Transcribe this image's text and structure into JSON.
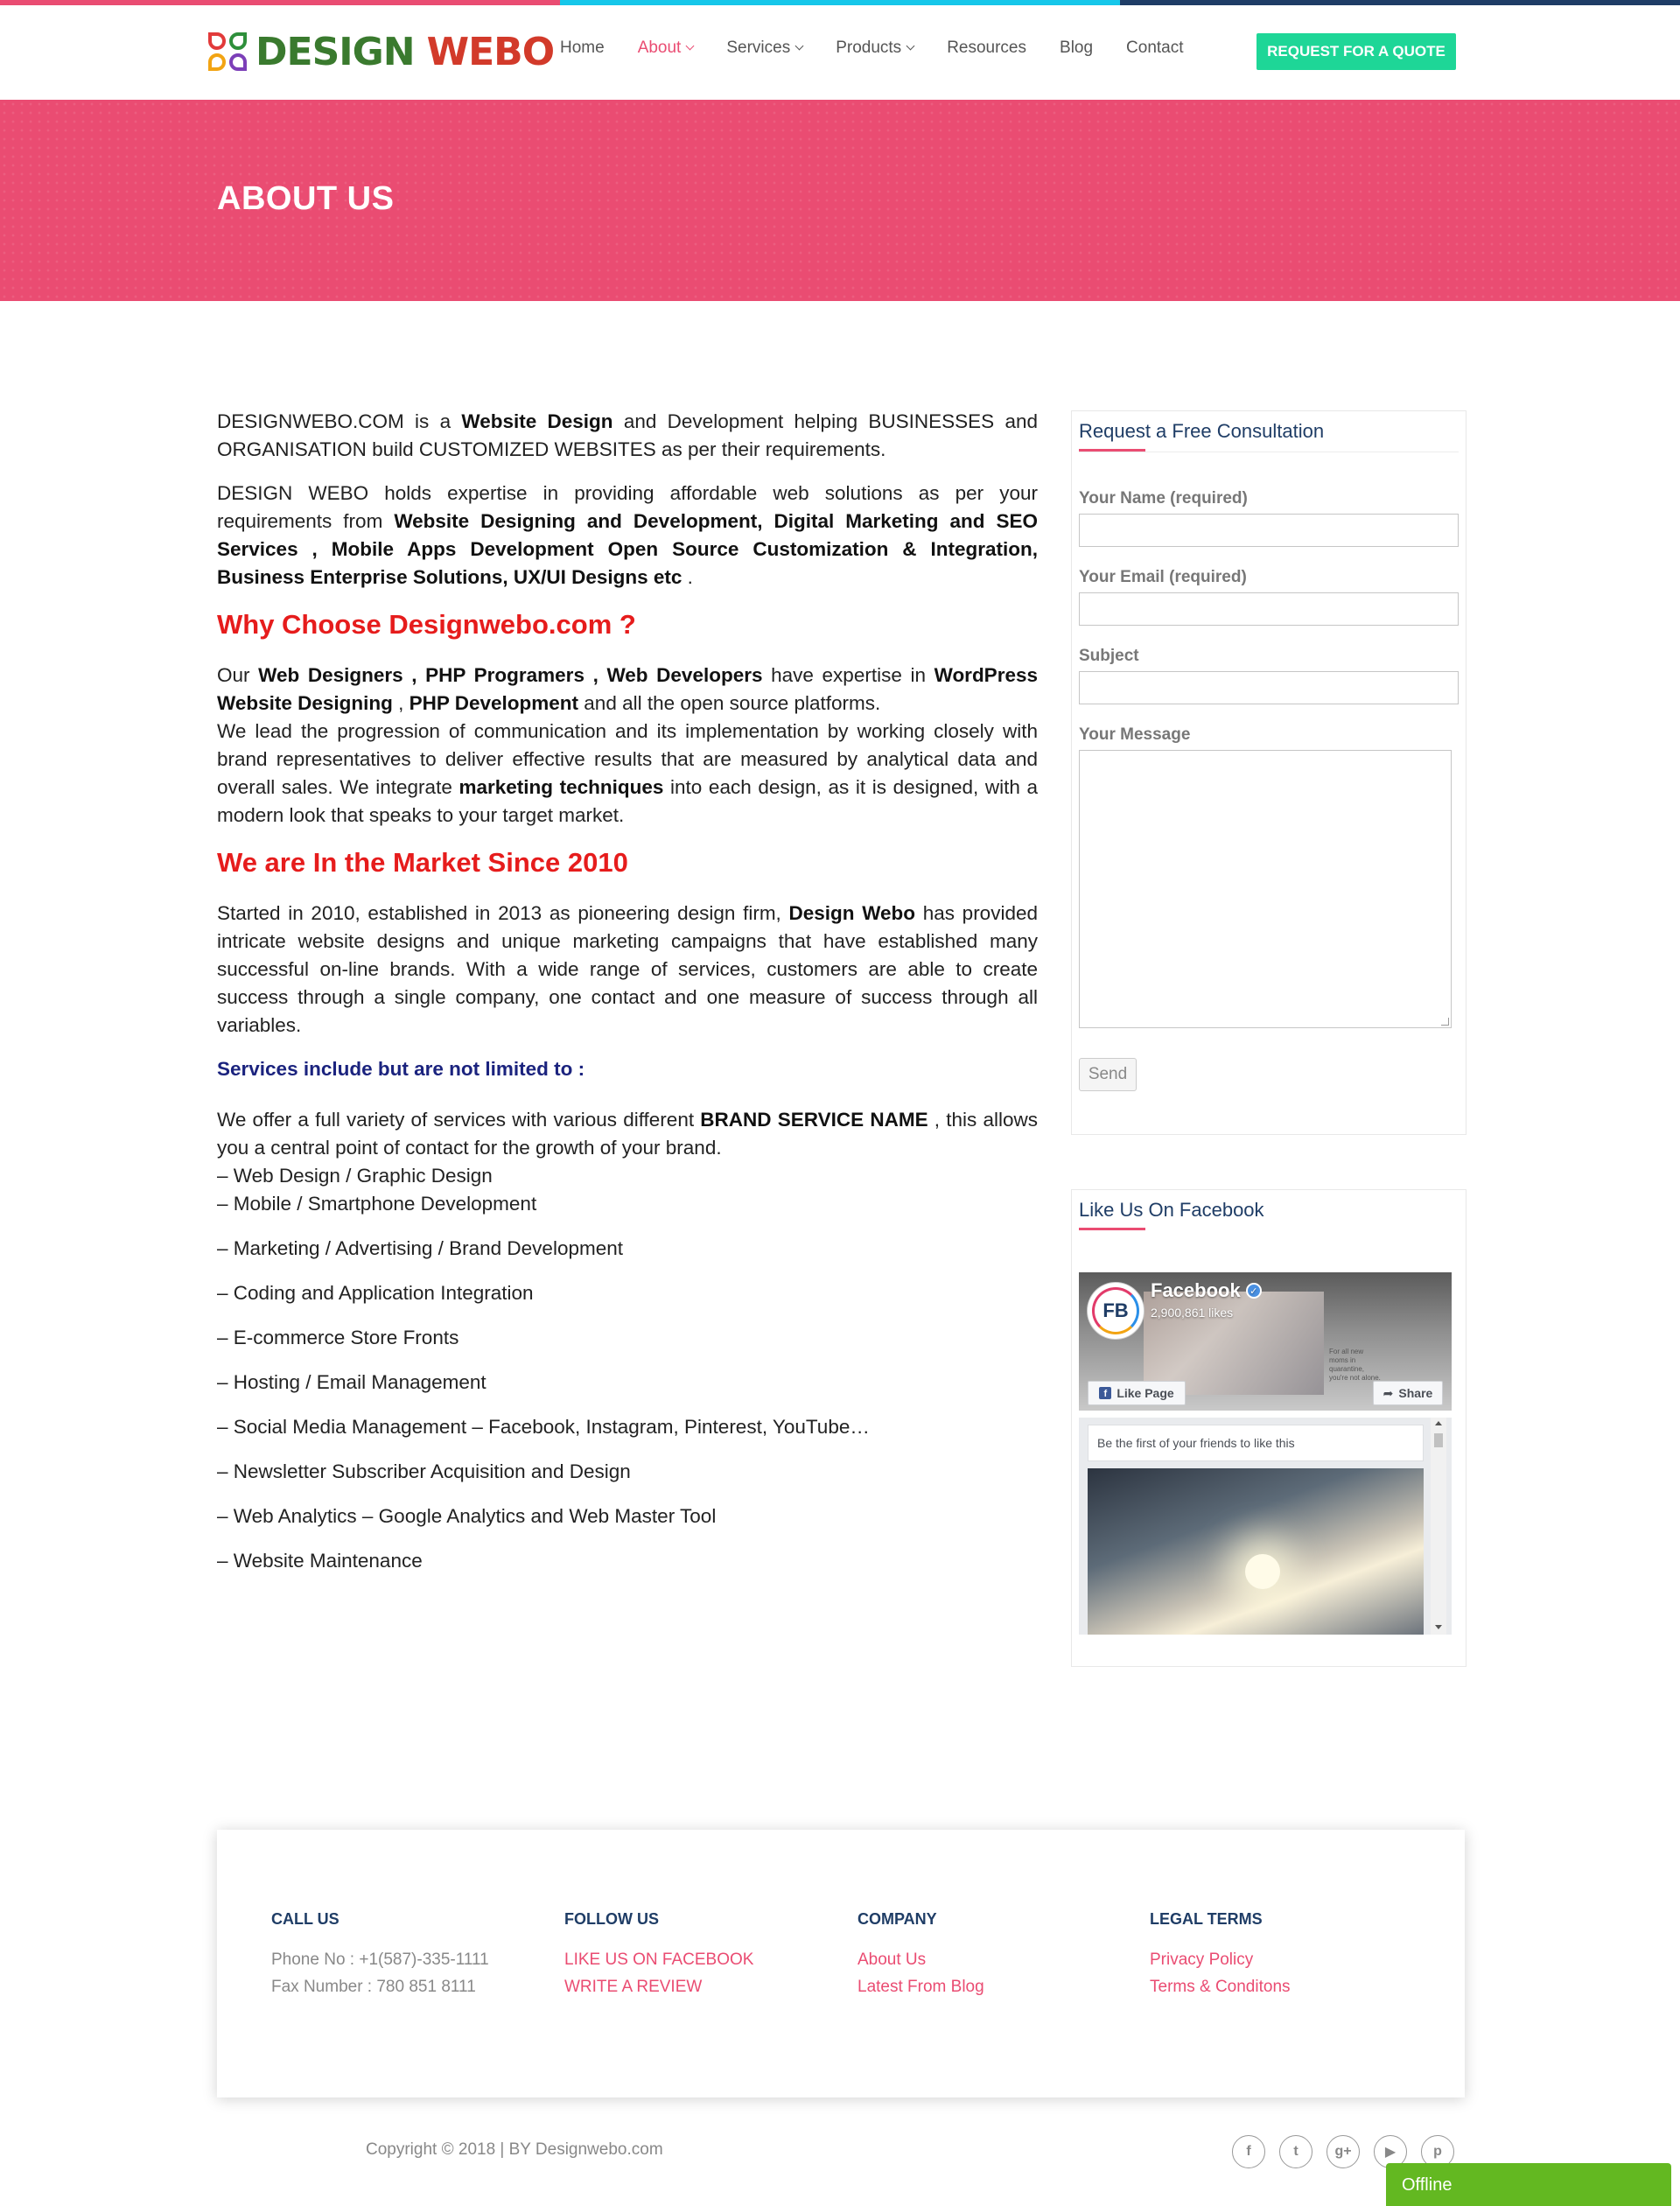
{
  "colors": {
    "accent": "#ea4c72",
    "cyan": "#16c7ea",
    "navy": "#1f3d66",
    "quote_button": "#1ed697",
    "heading_red": "#e61c1c",
    "offline_green": "#63b821"
  },
  "header": {
    "logo": {
      "word1": "DESIGN",
      "word2": "WEBO"
    },
    "nav": [
      {
        "label": "Home",
        "dropdown": false,
        "active": false
      },
      {
        "label": "About",
        "dropdown": true,
        "active": true
      },
      {
        "label": "Services",
        "dropdown": true,
        "active": false
      },
      {
        "label": "Products",
        "dropdown": true,
        "active": false
      },
      {
        "label": "Resources",
        "dropdown": false,
        "active": false
      },
      {
        "label": "Blog",
        "dropdown": false,
        "active": false
      },
      {
        "label": "Contact",
        "dropdown": false,
        "active": false
      }
    ],
    "quote_button": "REQUEST FOR A QUOTE"
  },
  "hero": {
    "title": "ABOUT US"
  },
  "content": {
    "p1_a": "DESIGNWEBO.COM is a ",
    "p1_b": "Website Design",
    "p1_c": " and Development helping BUSINESSES and ORGANISATION build CUSTOMIZED WEBSITES as per their requirements.",
    "p2_a": "DESIGN WEBO holds expertise in providing affordable web solutions as per your requirements from ",
    "p2_b": "Website Designing and Development, Digital Marketing and SEO Services , Mobile Apps Development Open Source Customization & Integration, Business Enterprise Solutions, UX/UI Designs etc",
    "p2_c": " .",
    "h_why": "Why Choose Designwebo.com ?",
    "p3_a": "Our ",
    "p3_b": "Web Designers , PHP Programers , Web Developers",
    "p3_c": " have expertise in ",
    "p3_d": "WordPress Website Designing",
    "p3_e": " , ",
    "p3_f": "PHP Development",
    "p3_g": " and all the open source platforms.",
    "p4_a": "We lead the progression of communication and its implementation by working closely with brand representatives to deliver effective results that are measured by analytical data and overall sales. We integrate ",
    "p4_b": "marketing techniques",
    "p4_c": " into each design, as it is designed, with a modern look that speaks to your target market.",
    "h_market": "We are In the Market Since 2010",
    "p5_a": "Started in 2010, established in 2013 as pioneering design firm, ",
    "p5_b": "Design Webo",
    "p5_c": " has provided intricate website designs and unique marketing campaigns that have established many successful on-line brands. With a wide range of services, customers are able to create success through a single company, one contact and one measure of success through all variables.",
    "h_services": "Services include but are not limited to :",
    "p6_a": "We offer a full variety of services with various different ",
    "p6_b": "BRAND SERVICE NAME",
    "p6_c": " , this allows you a central point of contact for the growth of your brand.",
    "services": [
      "– Web Design / Graphic Design",
      "–  Mobile / Smartphone Development",
      "–  Marketing / Advertising / Brand Development",
      "–  Coding and Application Integration",
      "–  E-commerce Store Fronts",
      "–  Hosting / Email Management",
      "–  Social Media Management – Facebook, Instagram, Pinterest, YouTube…",
      "–  Newsletter Subscriber Acquisition and Design",
      "–  Web Analytics – Google Analytics and Web Master Tool",
      "–  Website Maintenance"
    ]
  },
  "consultation": {
    "title": "Request a Free Consultation",
    "name_label": "Your Name (required)",
    "email_label": "Your Email (required)",
    "subject_label": "Subject",
    "message_label": "Your Message",
    "send": "Send"
  },
  "facebook_widget": {
    "title": "Like Us On Facebook",
    "page_name": "Facebook",
    "avatar_text": "FB",
    "likes": "2,900,861 likes",
    "cover_note": "For all new moms in quarantine, you're not alone.",
    "like_button": "Like Page",
    "share_button": "Share",
    "first_friends": "Be the first of your friends to like this"
  },
  "footer": {
    "call": {
      "title": "CALL US",
      "phone": "Phone No : +1(587)-335-1111",
      "fax": "Fax Number : 780 851 8111"
    },
    "follow": {
      "title": "FOLLOW US",
      "links": [
        "LIKE US ON FACEBOOK",
        "WRITE A REVIEW"
      ]
    },
    "company": {
      "title": "COMPANY",
      "links": [
        "About Us",
        "Latest From Blog"
      ]
    },
    "legal": {
      "title": "LEGAL TERMS",
      "links": [
        "Privacy Policy",
        "Terms & Conditons"
      ]
    },
    "copyright": "Copyright © 2018 | BY Designwebo.com",
    "socials": [
      {
        "icon": "facebook-icon",
        "glyph": "f"
      },
      {
        "icon": "twitter-icon",
        "glyph": "t"
      },
      {
        "icon": "google-plus-icon",
        "glyph": "g+"
      },
      {
        "icon": "youtube-icon",
        "glyph": "▶"
      },
      {
        "icon": "pinterest-icon",
        "glyph": "p"
      }
    ]
  },
  "chat": {
    "status": "Offline"
  }
}
